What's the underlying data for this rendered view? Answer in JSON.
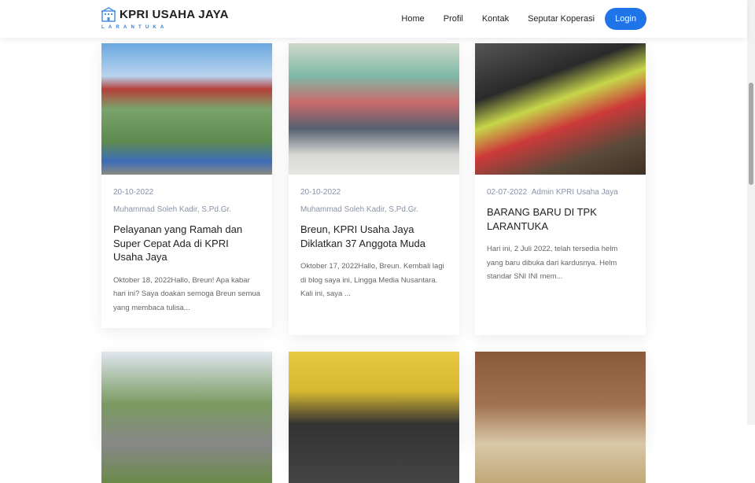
{
  "brand": {
    "title": "KPRI USAHA JAYA",
    "subtitle": "LARANTUKA"
  },
  "nav": [
    "Home",
    "Profil",
    "Kontak",
    "Seputar Koperasi"
  ],
  "login": "Login",
  "posts": [
    {
      "date": "20-10-2022",
      "author": "Muhammad Soleh Kadir, S.Pd.Gr.",
      "title": "Pelayanan yang Ramah dan Super Cepat Ada di KPRI Usaha Jaya",
      "excerpt": "Oktober 18, 2022Hallo, Breun! Apa kabar hari ini? Saya doakan semoga Breun semua yang membaca tulisa..."
    },
    {
      "date": "20-10-2022",
      "author": "Muhammad Soleh Kadir, S.Pd.Gr.",
      "title": "Breun, KPRI Usaha Jaya Diklatkan 37 Anggota Muda",
      "excerpt": "Oktober 17, 2022Hallo, Breun. Kembali lagi di blog saya ini, Lingga Media Nusantara. Kali ini, saya ..."
    },
    {
      "date": "02-07-2022",
      "author": "Admin KPRI Usaha Jaya",
      "title": "BARANG BARU DI TPK LARANTUKA",
      "excerpt": "Hari ini, 2 Juli 2022, telah tersedia helm yang baru dibuka dari kardusnya. Helm standar SNI INI mem..."
    }
  ]
}
